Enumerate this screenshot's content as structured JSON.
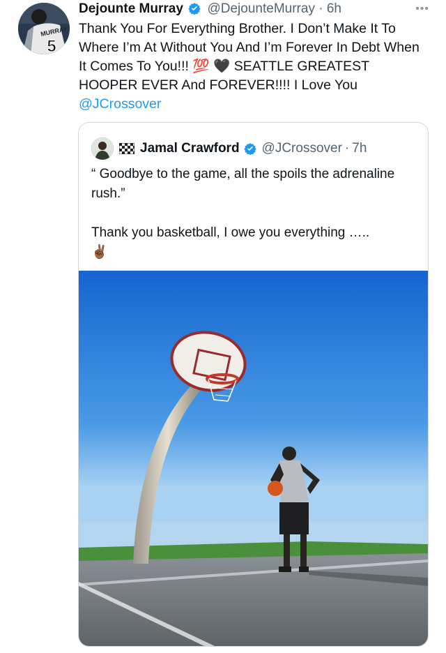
{
  "tweet": {
    "name": "Dejounte Murray",
    "handle": "@DejounteMurray",
    "dot": "·",
    "time": "6h",
    "more": "•••",
    "text_before": "Thank You For Everything Brother. I Don’t Make It To Where I’m At Without You And I’m Forever In Debt When It Comes To You!!! 💯 🖤 SEATTLE GREATEST HOOPER EVER And FOREVER!!!! I Love You ",
    "mention": "@JCrossover",
    "avatar_jersey_text": "MURRAY",
    "avatar_jersey_number": "5"
  },
  "quote": {
    "name": "Jamal Crawford",
    "handle": "@JCrossover",
    "dot": "·",
    "time": "7h",
    "line1": "“ Goodbye to the game, all the spoils the adrenaline rush.”",
    "line2": "Thank you basketball, I owe you everything …..",
    "emoji": "✌🏾"
  },
  "colors": {
    "link": "#1d9bf0",
    "verified": "#1d9bf0",
    "sky_top": "#1a73d9",
    "sky_bottom": "#a9d2f2",
    "grass": "#3f8f3a",
    "court": "#6f7579"
  }
}
